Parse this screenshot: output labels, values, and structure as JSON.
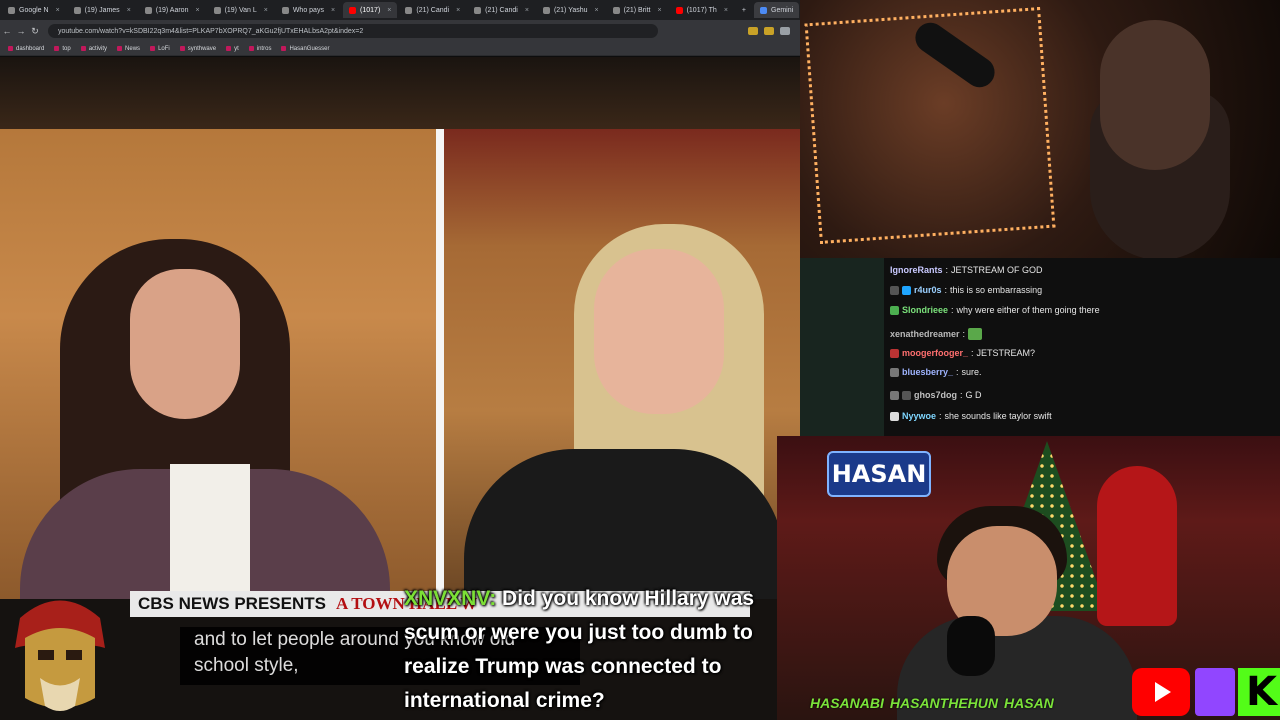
{
  "browser": {
    "tabs": [
      {
        "label": "Google N"
      },
      {
        "label": "(19) James"
      },
      {
        "label": "(19) Aaron"
      },
      {
        "label": "(19) Van L"
      },
      {
        "label": "Who pays"
      },
      {
        "label": "(1017)"
      },
      {
        "label": "(21) Candi"
      },
      {
        "label": "(21) Candi"
      },
      {
        "label": "(21) Yashu"
      },
      {
        "label": "(21) Britt"
      },
      {
        "label": "(1017) Th"
      },
      {
        "label": "Gemini"
      }
    ],
    "url": "youtube.com/watch?v=kSDBI22q3m4&list=PLKAP7bXOPRQ7_aKGu2fjUTxEHALbsA2pt&index=2",
    "bookmarks": [
      "dashboard",
      "top",
      "activity",
      "News",
      "LoFi",
      "synthwave",
      "yt",
      "intros",
      "HasanGuesser"
    ]
  },
  "video": {
    "banner_network": "CBS NEWS PRESENTS",
    "banner_title": "A TOWN HALL W",
    "caption_line1": "and to let people around you know old",
    "caption_line2": "school style,"
  },
  "chat": {
    "messages": [
      {
        "user": "IgnoreRants",
        "text": "JETSTREAM OF GOD",
        "color": "#c9c9ff"
      },
      {
        "user": "r4ur0s",
        "text": "this is so embarrassing",
        "color": "#9bd0ff"
      },
      {
        "user": "Slondrieee",
        "text": "why were either of them going there",
        "color": "#7ae07a"
      },
      {
        "user": "xenathedreamer",
        "text": "",
        "color": "#b9b9b9"
      },
      {
        "user": "moogerfooger_",
        "text": "JETSTREAM?",
        "color": "#ff6f6f"
      },
      {
        "user": "bluesberry_",
        "text": "sure.",
        "color": "#9fb4ff"
      },
      {
        "user": "ghos7dog",
        "text": "G   D",
        "color": "#c0c0c0"
      },
      {
        "user": "Nyywoe",
        "text": "she sounds like taylor swift",
        "color": "#7fd6ff"
      }
    ]
  },
  "overlay": {
    "chat_user": "XNVXNV:",
    "chat_text": "Did you know Hillary was scum or were you just too dumb to realize Trump was connected to international crime?",
    "streamer_logo": "HASAN",
    "handles": [
      "HASANABI",
      "HASANTHEHUN",
      "HASAN"
    ]
  },
  "colors": {
    "youtube": "#ff0000",
    "twitch": "#9146ff",
    "kick": "#53fc18",
    "cbs_red": "#b30f12"
  }
}
